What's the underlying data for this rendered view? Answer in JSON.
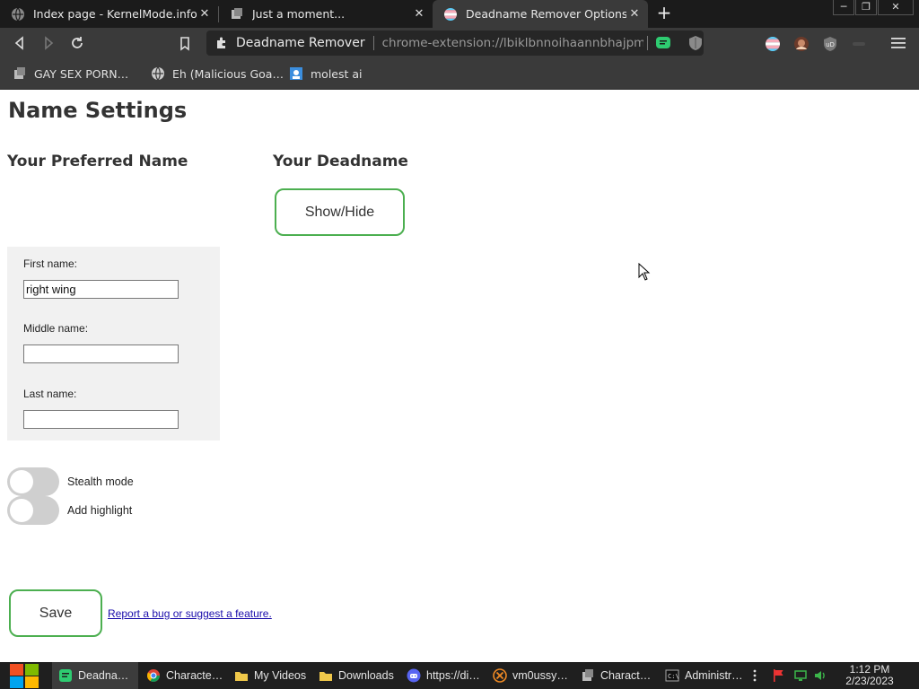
{
  "browser": {
    "tabs": [
      {
        "title": "Index page - KernelMode.info",
        "icon": "globe-icon",
        "active": false
      },
      {
        "title": "Just a moment...",
        "icon": "loading-icon",
        "active": false
      },
      {
        "title": "Deadname Remover Options",
        "icon": "trans-flag-icon",
        "active": true
      }
    ],
    "omnibox": {
      "extension_name": "Deadname Remover",
      "url": "chrome-extension://lbiklbnnoihaannbhajpmp..."
    },
    "bookmarks": [
      {
        "label": "GAY SEX PORN…",
        "icon": "stack-icon"
      },
      {
        "label": "Eh (Malicious Goa…",
        "icon": "globe-icon"
      },
      {
        "label": "molest ai",
        "icon": "image-icon"
      }
    ]
  },
  "page": {
    "title": "Name Settings",
    "preferred_heading": "Your Preferred Name",
    "deadname_heading": "Your Deadname",
    "show_hide_label": "Show/Hide",
    "fields": {
      "first": {
        "label": "First name:",
        "value": "right wing"
      },
      "middle": {
        "label": "Middle name:",
        "value": ""
      },
      "last": {
        "label": "Last name:",
        "value": ""
      }
    },
    "toggles": {
      "stealth": {
        "label": "Stealth mode",
        "on": false
      },
      "highlight": {
        "label": "Add highlight",
        "on": false
      }
    },
    "save_label": "Save",
    "report_link": "Report a bug or suggest a feature."
  },
  "taskbar": {
    "items": [
      {
        "label": "Deadna…",
        "icon": "green-app-icon",
        "active": true
      },
      {
        "label": "Characte…",
        "icon": "chrome-icon",
        "active": false
      },
      {
        "label": "My Videos",
        "icon": "folder-icon",
        "active": false
      },
      {
        "label": "Downloads",
        "icon": "folder-icon",
        "active": false
      },
      {
        "label": "https://di…",
        "icon": "discord-icon",
        "active": false
      },
      {
        "label": "vm0ussy…",
        "icon": "x-app-icon",
        "active": false
      },
      {
        "label": "Charact…",
        "icon": "app-icon",
        "active": false
      },
      {
        "label": "Administr…",
        "icon": "cmd-icon",
        "active": false
      }
    ],
    "clock_time": "1:12 PM",
    "clock_date": "2/23/2023"
  },
  "colors": {
    "accent_green": "#4caf50",
    "link_blue": "#1a0dab",
    "chrome_dark": "#3a3a3a"
  }
}
